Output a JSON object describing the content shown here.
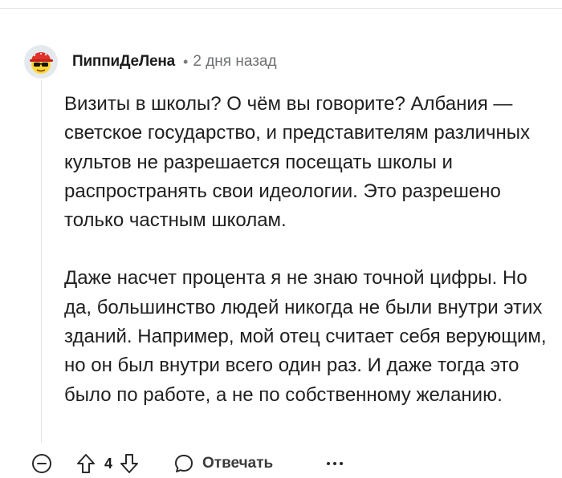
{
  "comment": {
    "author": "ПиппиДеЛена",
    "separator": "•",
    "timestamp": "2 дня назад",
    "paragraphs": [
      "Визиты в школы? О чём вы говорите? Албания — светское государство, и представителям различных культов не разрешается посещать школы и распространять свои идеологии. Это разрешено только частным школам.",
      "Даже насчет процента я не знаю точной цифры. Но да, большинство людей никогда не были внутри этих зданий. Например, мой отец считает себя верующим, но он был внутри всего один раз. И даже тогда это было по работе, а не по собственному желанию."
    ]
  },
  "actions": {
    "collapse_icon": "collapse-minus-icon",
    "upvote_icon": "arrow-up-icon",
    "vote_count": "4",
    "downvote_icon": "arrow-down-icon",
    "reply_icon": "speech-bubble-icon",
    "reply_label": "Отвечать",
    "more_icon": "ellipsis-icon"
  },
  "colors": {
    "text": "#1f1f1f",
    "meta": "#6f7173",
    "icon": "#2a2a2a",
    "divider": "#e0e3e5",
    "avatar_bg": "#e4e9ee",
    "avatar_face": "#ffd635",
    "avatar_hat": "#e0322a"
  }
}
